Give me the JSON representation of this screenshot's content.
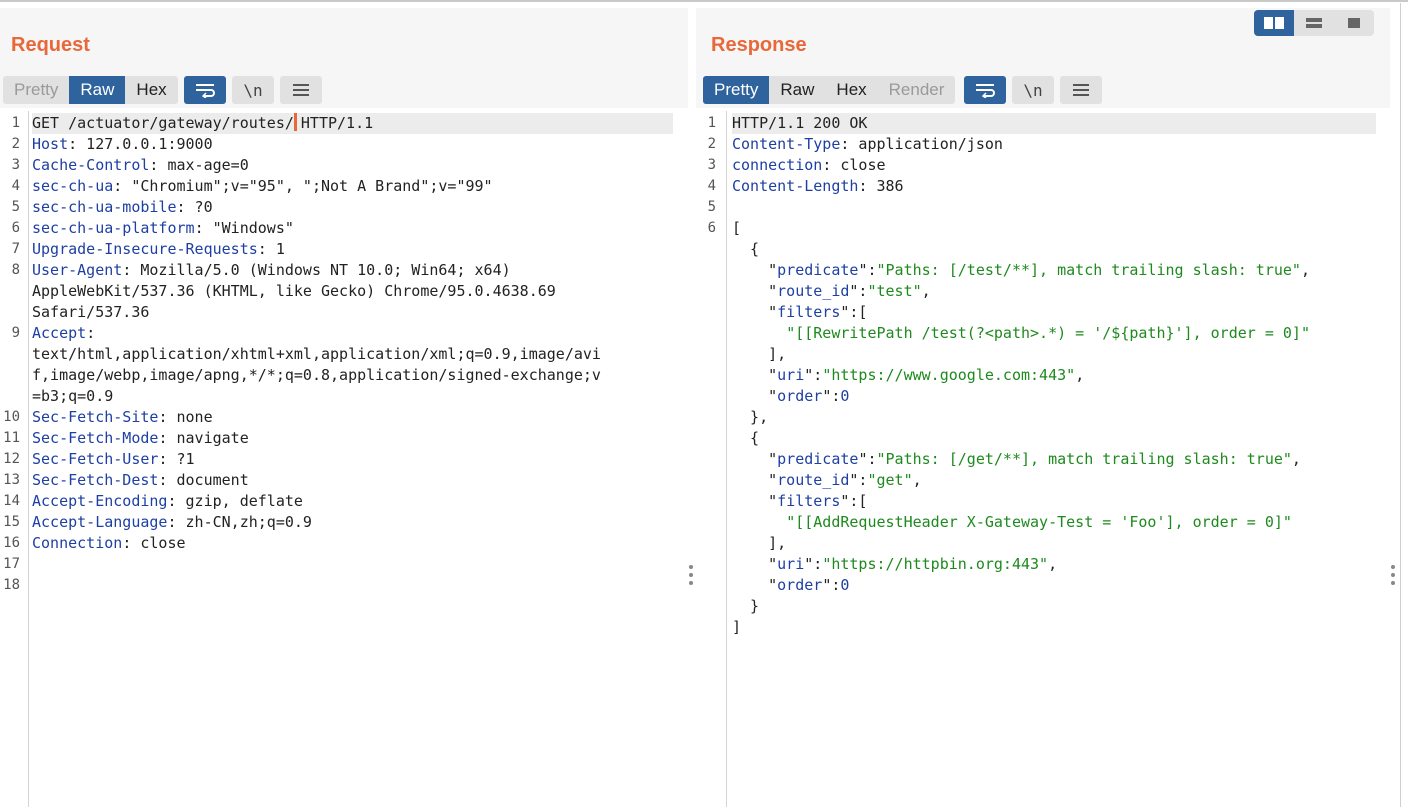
{
  "request": {
    "title": "Request",
    "tabs": [
      {
        "label": "Pretty",
        "state": "inactive"
      },
      {
        "label": "Raw",
        "state": "active"
      },
      {
        "label": "Hex",
        "state": "normal"
      }
    ],
    "lines": [
      {
        "n": "1",
        "parts": [
          [
            "p",
            "GET /actuator/gateway/routes/"
          ],
          [
            "cursor",
            ""
          ],
          [
            "p",
            "HTTP/1.1"
          ]
        ]
      },
      {
        "n": "2",
        "parts": [
          [
            "k",
            "Host"
          ],
          [
            "p",
            ": 127.0.0.1:9000"
          ]
        ]
      },
      {
        "n": "3",
        "parts": [
          [
            "k",
            "Cache-Control"
          ],
          [
            "p",
            ": max-age=0"
          ]
        ]
      },
      {
        "n": "4",
        "parts": [
          [
            "k",
            "sec-ch-ua"
          ],
          [
            "p",
            ": \"Chromium\";v=\"95\", \";Not A Brand\";v=\"99\""
          ]
        ]
      },
      {
        "n": "5",
        "parts": [
          [
            "k",
            "sec-ch-ua-mobile"
          ],
          [
            "p",
            ": ?0"
          ]
        ]
      },
      {
        "n": "6",
        "parts": [
          [
            "k",
            "sec-ch-ua-platform"
          ],
          [
            "p",
            ": \"Windows\""
          ]
        ]
      },
      {
        "n": "7",
        "parts": [
          [
            "k",
            "Upgrade-Insecure-Requests"
          ],
          [
            "p",
            ": 1"
          ]
        ]
      },
      {
        "n": "8",
        "parts": [
          [
            "k",
            "User-Agent"
          ],
          [
            "p",
            ": Mozilla/5.0 (Windows NT 10.0; Win64; x64)"
          ]
        ]
      },
      {
        "n": "",
        "parts": [
          [
            "p",
            "AppleWebKit/537.36 (KHTML, like Gecko) Chrome/95.0.4638.69"
          ]
        ]
      },
      {
        "n": "",
        "parts": [
          [
            "p",
            "Safari/537.36"
          ]
        ]
      },
      {
        "n": "9",
        "parts": [
          [
            "k",
            "Accept"
          ],
          [
            "p",
            ":"
          ]
        ]
      },
      {
        "n": "",
        "parts": [
          [
            "p",
            "text/html,application/xhtml+xml,application/xml;q=0.9,image/avi"
          ]
        ]
      },
      {
        "n": "",
        "parts": [
          [
            "p",
            "f,image/webp,image/apng,*/*;q=0.8,application/signed-exchange;v"
          ]
        ]
      },
      {
        "n": "",
        "parts": [
          [
            "p",
            "=b3;q=0.9"
          ]
        ]
      },
      {
        "n": "10",
        "parts": [
          [
            "k",
            "Sec-Fetch-Site"
          ],
          [
            "p",
            ": none"
          ]
        ]
      },
      {
        "n": "11",
        "parts": [
          [
            "k",
            "Sec-Fetch-Mode"
          ],
          [
            "p",
            ": navigate"
          ]
        ]
      },
      {
        "n": "12",
        "parts": [
          [
            "k",
            "Sec-Fetch-User"
          ],
          [
            "p",
            ": ?1"
          ]
        ]
      },
      {
        "n": "13",
        "parts": [
          [
            "k",
            "Sec-Fetch-Dest"
          ],
          [
            "p",
            ": document"
          ]
        ]
      },
      {
        "n": "14",
        "parts": [
          [
            "k",
            "Accept-Encoding"
          ],
          [
            "p",
            ": gzip, deflate"
          ]
        ]
      },
      {
        "n": "15",
        "parts": [
          [
            "k",
            "Accept-Language"
          ],
          [
            "p",
            ": zh-CN,zh;q=0.9"
          ]
        ]
      },
      {
        "n": "16",
        "parts": [
          [
            "k",
            "Connection"
          ],
          [
            "p",
            ": close"
          ]
        ]
      },
      {
        "n": "17",
        "parts": []
      },
      {
        "n": "18",
        "parts": []
      }
    ]
  },
  "response": {
    "title": "Response",
    "tabs": [
      {
        "label": "Pretty",
        "state": "active"
      },
      {
        "label": "Raw",
        "state": "normal"
      },
      {
        "label": "Hex",
        "state": "normal"
      },
      {
        "label": "Render",
        "state": "disabled"
      }
    ],
    "lines": [
      {
        "n": "1",
        "parts": [
          [
            "p",
            "HTTP/1.1 200 OK"
          ]
        ]
      },
      {
        "n": "2",
        "parts": [
          [
            "k",
            "Content-Type"
          ],
          [
            "p",
            ": application/json"
          ]
        ]
      },
      {
        "n": "3",
        "parts": [
          [
            "k",
            "connection"
          ],
          [
            "p",
            ": close"
          ]
        ]
      },
      {
        "n": "4",
        "parts": [
          [
            "k",
            "Content-Length"
          ],
          [
            "p",
            ": 386"
          ]
        ]
      },
      {
        "n": "5",
        "parts": []
      },
      {
        "n": "6",
        "parts": [
          [
            "p",
            "["
          ]
        ]
      },
      {
        "n": "",
        "parts": [
          [
            "p",
            "  {"
          ]
        ]
      },
      {
        "n": "",
        "parts": [
          [
            "p",
            "    \""
          ],
          [
            "k",
            "predicate"
          ],
          [
            "p",
            "\":"
          ],
          [
            "s",
            "\"Paths: [/test/**], match trailing slash: true\""
          ],
          [
            "p",
            ","
          ]
        ]
      },
      {
        "n": "",
        "parts": [
          [
            "p",
            "    \""
          ],
          [
            "k",
            "route_id"
          ],
          [
            "p",
            "\":"
          ],
          [
            "s",
            "\"test\""
          ],
          [
            "p",
            ","
          ]
        ]
      },
      {
        "n": "",
        "parts": [
          [
            "p",
            "    \""
          ],
          [
            "k",
            "filters"
          ],
          [
            "p",
            "\":["
          ]
        ]
      },
      {
        "n": "",
        "parts": [
          [
            "p",
            "      "
          ],
          [
            "s",
            "\"[[RewritePath /test(?<path>.*) = '/${path}'], order = 0]\""
          ]
        ]
      },
      {
        "n": "",
        "parts": [
          [
            "p",
            "    ],"
          ]
        ]
      },
      {
        "n": "",
        "parts": [
          [
            "p",
            "    \""
          ],
          [
            "k",
            "uri"
          ],
          [
            "p",
            "\":"
          ],
          [
            "s",
            "\"https://www.google.com:443\""
          ],
          [
            "p",
            ","
          ]
        ]
      },
      {
        "n": "",
        "parts": [
          [
            "p",
            "    \""
          ],
          [
            "k",
            "order"
          ],
          [
            "p",
            "\":"
          ],
          [
            "n",
            "0"
          ]
        ]
      },
      {
        "n": "",
        "parts": [
          [
            "p",
            "  },"
          ]
        ]
      },
      {
        "n": "",
        "parts": [
          [
            "p",
            "  {"
          ]
        ]
      },
      {
        "n": "",
        "parts": [
          [
            "p",
            "    \""
          ],
          [
            "k",
            "predicate"
          ],
          [
            "p",
            "\":"
          ],
          [
            "s",
            "\"Paths: [/get/**], match trailing slash: true\""
          ],
          [
            "p",
            ","
          ]
        ]
      },
      {
        "n": "",
        "parts": [
          [
            "p",
            "    \""
          ],
          [
            "k",
            "route_id"
          ],
          [
            "p",
            "\":"
          ],
          [
            "s",
            "\"get\""
          ],
          [
            "p",
            ","
          ]
        ]
      },
      {
        "n": "",
        "parts": [
          [
            "p",
            "    \""
          ],
          [
            "k",
            "filters"
          ],
          [
            "p",
            "\":["
          ]
        ]
      },
      {
        "n": "",
        "parts": [
          [
            "p",
            "      "
          ],
          [
            "s",
            "\"[[AddRequestHeader X-Gateway-Test = 'Foo'], order = 0]\""
          ]
        ]
      },
      {
        "n": "",
        "parts": [
          [
            "p",
            "    ],"
          ]
        ]
      },
      {
        "n": "",
        "parts": [
          [
            "p",
            "    \""
          ],
          [
            "k",
            "uri"
          ],
          [
            "p",
            "\":"
          ],
          [
            "s",
            "\"https://httpbin.org:443\""
          ],
          [
            "p",
            ","
          ]
        ]
      },
      {
        "n": "",
        "parts": [
          [
            "p",
            "    \""
          ],
          [
            "k",
            "order"
          ],
          [
            "p",
            "\":"
          ],
          [
            "n",
            "0"
          ]
        ]
      },
      {
        "n": "",
        "parts": [
          [
            "p",
            "  }"
          ]
        ]
      },
      {
        "n": "",
        "parts": [
          [
            "p",
            "]"
          ]
        ]
      }
    ]
  },
  "toolbar_icons": {
    "wrap": "wrap-lines-icon",
    "newline": "\\n",
    "menu": "menu-icon"
  },
  "layout_modes": [
    "side-by-side",
    "top-bottom",
    "single"
  ],
  "colors": {
    "title": "#e8683a",
    "active_tab": "#2e639d",
    "header_key": "#1e3fa3",
    "json_string": "#1e8a1e"
  }
}
